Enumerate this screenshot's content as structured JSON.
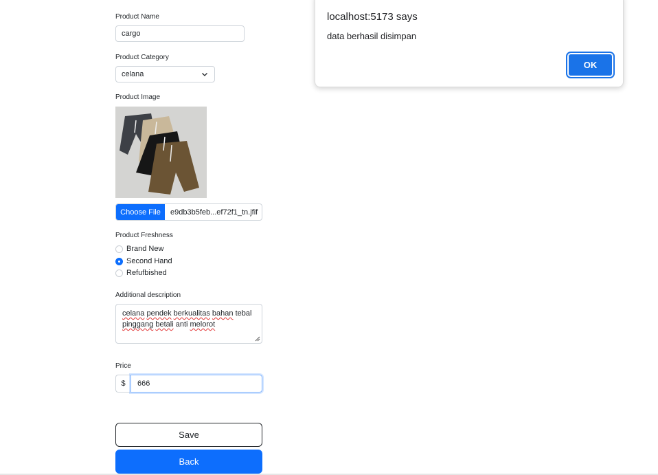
{
  "form": {
    "product_name_label": "Product Name",
    "product_name_value": "cargo",
    "product_category_label": "Product Category",
    "product_category_value": "celana",
    "product_image_label": "Product Image",
    "image_icon": "cargo-shorts-photo",
    "choose_file_label": "Choose File",
    "file_name": "e9db3b5feb...ef72f1_tn.jfif",
    "freshness_label": "Product Freshness",
    "freshness_options": [
      {
        "label": "Brand New",
        "selected": false
      },
      {
        "label": "Second Hand",
        "selected": true
      },
      {
        "label": "Refufbished",
        "selected": false
      }
    ],
    "description_label": "Additional description",
    "description_line1_words": [
      "celana",
      "pendek",
      "berkualitas",
      "bahan",
      "tebal"
    ],
    "description_line2_words": [
      "pinggang",
      "betali",
      "anti",
      "melorot"
    ],
    "price_label": "Price",
    "price_prefix": "$",
    "price_value": "666",
    "save_label": "Save",
    "back_label": "Back"
  },
  "dialog": {
    "title": "localhost:5173 says",
    "message": "data berhasil disimpan",
    "ok_label": "OK"
  },
  "colors": {
    "primary": "#0d6efd",
    "dialog_button": "#1a73e8"
  }
}
